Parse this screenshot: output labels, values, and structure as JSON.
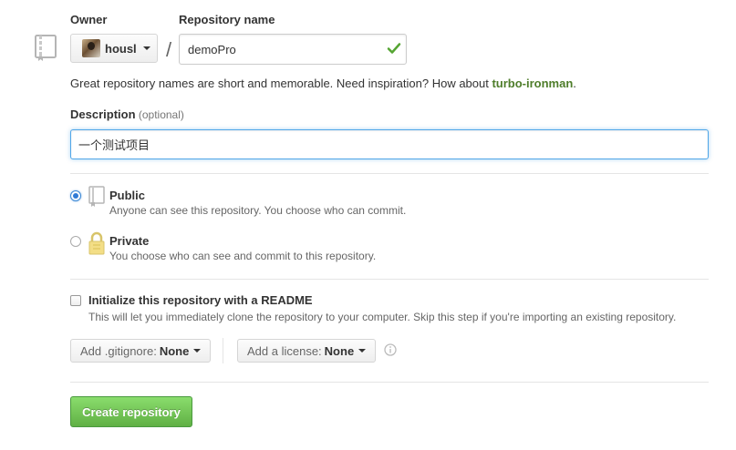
{
  "owner": {
    "label": "Owner",
    "username": "housl"
  },
  "repo_name": {
    "label": "Repository name",
    "value": "demoPro",
    "separator": "/"
  },
  "hint": {
    "text": "Great repository names are short and memorable. Need inspiration? How about ",
    "suggestion": "turbo-ironman",
    "suffix": "."
  },
  "description": {
    "label": "Description",
    "optional": "(optional)",
    "value": "一个测试项目"
  },
  "visibility": {
    "public": {
      "title": "Public",
      "desc": "Anyone can see this repository. You choose who can commit.",
      "selected": true
    },
    "private": {
      "title": "Private",
      "desc": "You choose who can see and commit to this repository.",
      "selected": false
    }
  },
  "readme": {
    "title": "Initialize this repository with a README",
    "desc": "This will let you immediately clone the repository to your computer. Skip this step if you're importing an existing repository.",
    "checked": false
  },
  "gitignore": {
    "prefix": "Add .gitignore:",
    "value": "None"
  },
  "license": {
    "prefix": "Add a license:",
    "value": "None"
  },
  "create_button": "Create repository",
  "colors": {
    "accent_blue": "#51a7e8",
    "create_green": "#60b044",
    "check_green": "#55a532",
    "suggestion_green": "#4e7d2a"
  }
}
